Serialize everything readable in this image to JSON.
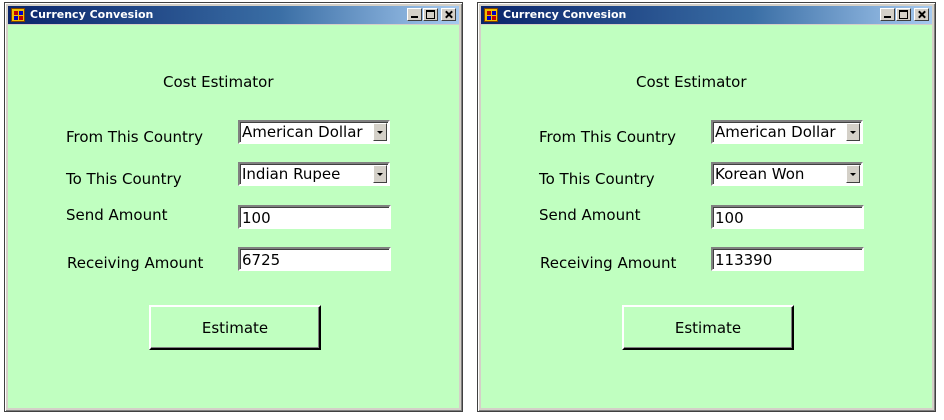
{
  "windows": [
    {
      "title": "Currency Convesion",
      "heading": "Cost Estimator",
      "from_label": "From This Country",
      "from_value": "American Dollar",
      "to_label": "To This Country",
      "to_value": "Indian Rupee",
      "send_label": "Send Amount",
      "send_value": "100",
      "receive_label": "Receiving Amount",
      "receive_value": "6725",
      "button_label": "Estimate"
    },
    {
      "title": "Currency Convesion",
      "heading": "Cost Estimator",
      "from_label": "From This Country",
      "from_value": "American Dollar",
      "to_label": "To This Country",
      "to_value": "Korean Won",
      "send_label": "Send Amount",
      "send_value": "100",
      "receive_label": "Receiving Amount",
      "receive_value": "113390",
      "button_label": "Estimate"
    }
  ],
  "colors": {
    "client_background": "#c0ffc0",
    "titlebar_active": "#0a246a"
  },
  "icons": {
    "app": "app-icon",
    "minimize": "minimize-icon",
    "maximize": "maximize-icon",
    "close": "close-icon",
    "dropdown": "dropdown-arrow-icon"
  }
}
